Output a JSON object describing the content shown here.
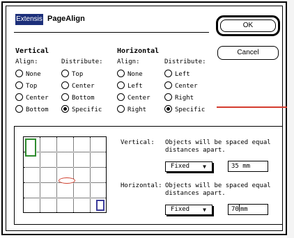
{
  "dialog": {
    "logo_text": "Extensis",
    "title": "PageAlign",
    "ok_label": "OK",
    "cancel_label": "Cancel"
  },
  "vertical": {
    "heading": "Vertical",
    "align_label": "Align:",
    "align_options": [
      "None",
      "Top",
      "Center",
      "Bottom"
    ],
    "align_selected": "",
    "distribute_label": "Distribute:",
    "distribute_options": [
      "Top",
      "Center",
      "Bottom",
      "Specific"
    ],
    "distribute_selected": "Specific"
  },
  "horizontal": {
    "heading": "Horizontal",
    "align_label": "Align:",
    "align_options": [
      "None",
      "Left",
      "Center",
      "Right"
    ],
    "align_selected": "",
    "distribute_label": "Distribute:",
    "distribute_options": [
      "Left",
      "Center",
      "Right",
      "Specific"
    ],
    "distribute_selected": "Specific"
  },
  "spacing": {
    "vertical": {
      "label": "Vertical:",
      "description_line1": "Objects will be spaced equal",
      "description_line2": "distances apart.",
      "mode": "Fixed",
      "value": "35 mm"
    },
    "horizontal": {
      "label": "Horizontal:",
      "description_line1": "Objects will be spaced equal",
      "description_line2": "distances apart.",
      "mode": "Fixed",
      "value_before_caret": "70",
      "value_after_caret": "mm"
    }
  },
  "colors": {
    "logo_bg": "#1c2f7a",
    "preview_green": "#2e8b2e",
    "preview_red": "#d0402e",
    "preview_blue": "#3c3c9a",
    "annotation_line": "#d43b2e"
  }
}
